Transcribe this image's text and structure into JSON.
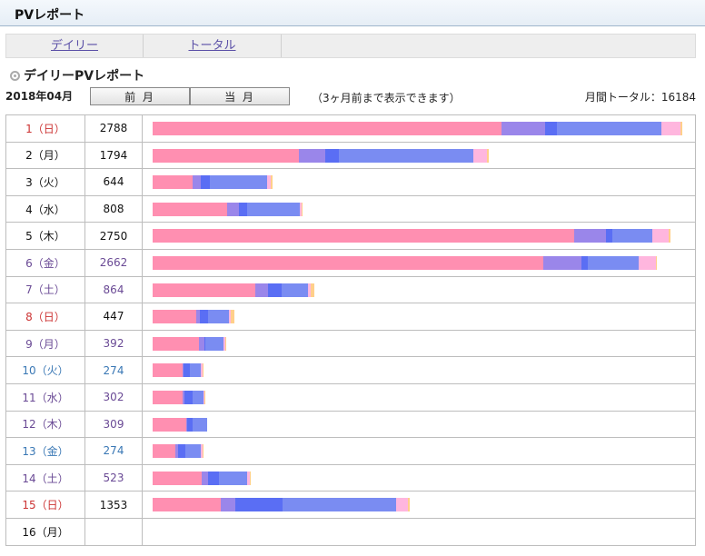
{
  "header": {
    "title": "PVレポート"
  },
  "tabs": [
    {
      "label": "デイリー"
    },
    {
      "label": "トータル"
    }
  ],
  "section": {
    "title": "デイリーPVレポート"
  },
  "controls": {
    "month_label": "2018年04月",
    "prev_month": "前 月",
    "this_month": "当 月",
    "note": "（3ヶ月前まで表示できます）",
    "monthly_total": "月間トータル：16184"
  },
  "colors": {
    "seg1": "#ff8fb1",
    "seg2": "#9a86ea",
    "seg3": "#5a6ef4",
    "seg4": "#7a8cf2",
    "seg5": "#ffb6de",
    "seg6": "#ffcf8a"
  },
  "chart_data": {
    "type": "bar",
    "categories": [
      "1（日）",
      "2（月）",
      "3（火）",
      "4（水）",
      "5（木）",
      "6（金）",
      "7（土）",
      "8（日）",
      "9（月）",
      "10（火）",
      "11（水）",
      "12（木）",
      "13（金）",
      "14（土）",
      "15（日）",
      "16（月）"
    ],
    "values": [
      2788,
      1794,
      644,
      808,
      2750,
      2662,
      864,
      447,
      392,
      274,
      302,
      309,
      274,
      523,
      1353,
      null
    ],
    "value_labels": [
      "2788",
      "1794",
      "644",
      "808",
      "2750",
      "2662",
      "864",
      "447",
      "392",
      "274",
      "302",
      "309",
      "274",
      "523",
      "1353",
      ""
    ],
    "day_colors": [
      "sun",
      "blk",
      "blk",
      "blk",
      "blk",
      "pur",
      "pur",
      "sun",
      "pur",
      "blu",
      "pur",
      "pur",
      "blu",
      "pur",
      "sun",
      "blk"
    ],
    "segments": [
      [
        2000,
        250,
        70,
        600,
        110,
        8
      ],
      [
        840,
        150,
        80,
        770,
        80,
        10
      ],
      [
        228,
        50,
        50,
        330,
        20,
        10
      ],
      [
        425,
        70,
        50,
        300,
        10,
        5
      ],
      [
        2420,
        180,
        40,
        230,
        90,
        10
      ],
      [
        2240,
        220,
        40,
        290,
        100,
        5
      ],
      [
        590,
        70,
        80,
        150,
        20,
        20
      ],
      [
        250,
        20,
        50,
        120,
        10,
        20
      ],
      [
        265,
        30,
        10,
        100,
        10,
        5
      ],
      [
        170,
        5,
        40,
        60,
        10,
        5
      ],
      [
        170,
        15,
        45,
        60,
        10,
        5
      ],
      [
        195,
        5,
        30,
        85,
        0,
        0
      ],
      [
        130,
        15,
        45,
        85,
        10,
        5
      ],
      [
        280,
        40,
        60,
        160,
        20,
        5
      ],
      [
        390,
        85,
        270,
        650,
        70,
        10
      ],
      []
    ],
    "xlim": [
      0,
      3050
    ]
  }
}
